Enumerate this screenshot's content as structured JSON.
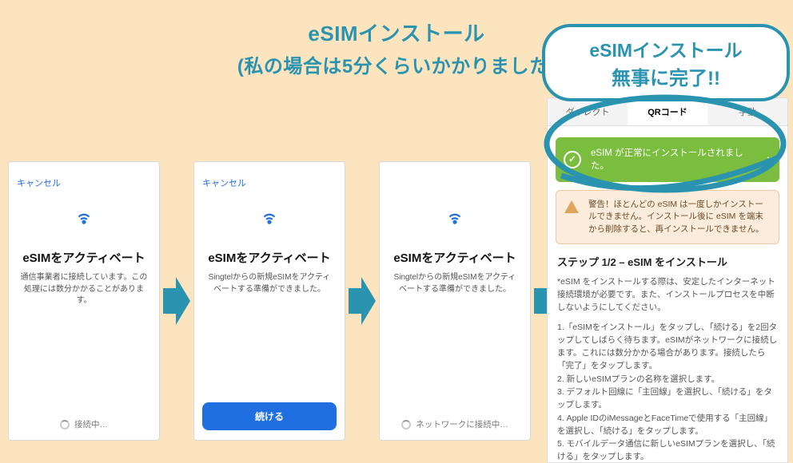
{
  "heading": {
    "line1": "eSIMインストール",
    "line2": "(私の場合は5分くらいかかりました)"
  },
  "phones": [
    {
      "cancel": "キャンセル",
      "title": "eSIMをアクティベート",
      "desc": "通信事業者に接続しています。この処理には数分かかることがあります。",
      "footer_type": "status",
      "footer_text": "接続中…"
    },
    {
      "cancel": "キャンセル",
      "title": "eSIMをアクティベート",
      "desc": "Singtelからの新規eSIMをアクティベートする準備ができました。",
      "footer_type": "button",
      "footer_text": "続ける"
    },
    {
      "cancel": "",
      "title": "eSIMをアクティベート",
      "desc": "Singtelからの新規eSIMをアクティベートする準備ができました。",
      "footer_type": "status",
      "footer_text": "ネットワークに接続中…"
    }
  ],
  "bubble": {
    "line1": "eSIMインストール",
    "line2": "無事に完了!!"
  },
  "app": {
    "tabs": {
      "t1": "ダイレクト",
      "t2": "QRコード",
      "t3": "手動",
      "active": 1
    },
    "ok_banner": "eSIM が正常にインストールされました。",
    "warn_banner": "警告！ほとんどの eSIM は一度しかインストールできません。インストール後に eSIM を端末から削除すると、再インストールできません。",
    "step_heading": "ステップ 1/2 – eSIM をインストール",
    "p1": "*eSIM をインストールする際は、安定したインターネット接続環境が必要です。また、インストールプロセスを中断しないようにしてください。",
    "p2": "1.「eSIMをインストール」をタップし、「続ける」を2回タップしてしばらく待ちます。eSIMがネットワークに接続します。これには数分かかる場合があります。接続したら「完了」をタップします。\n2. 新しいeSIMプランの名称を選択します。\n3. デフォルト回線に「主回線」を選択し、「続ける」をタップします。\n4. Apple IDのiMessageとFaceTimeで使用する「主回線」を選択し、「続ける」をタップします。\n5. モバイルデータ通信に新しいeSIMプランを選択し、「続ける」をタップします。"
  }
}
